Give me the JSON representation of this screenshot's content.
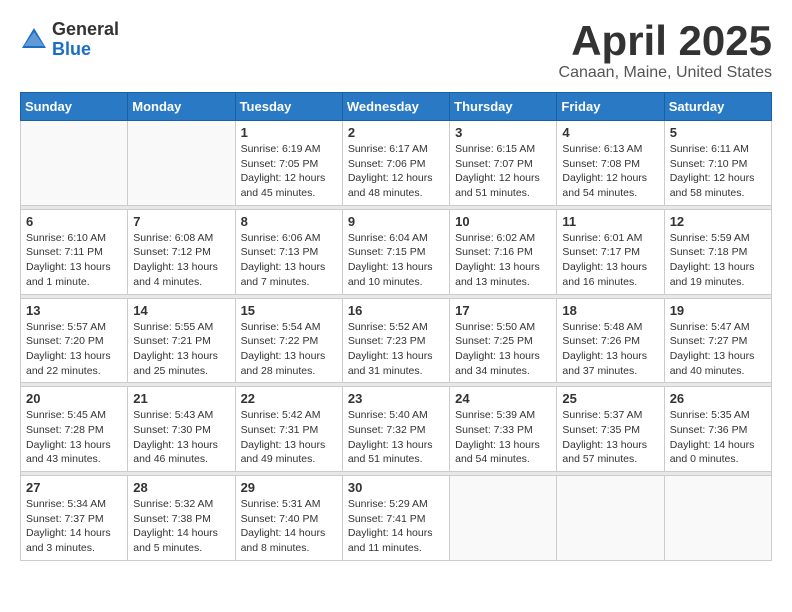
{
  "logo": {
    "general": "General",
    "blue": "Blue"
  },
  "title": "April 2025",
  "location": "Canaan, Maine, United States",
  "days_of_week": [
    "Sunday",
    "Monday",
    "Tuesday",
    "Wednesday",
    "Thursday",
    "Friday",
    "Saturday"
  ],
  "weeks": [
    [
      {
        "day": "",
        "info": ""
      },
      {
        "day": "",
        "info": ""
      },
      {
        "day": "1",
        "info": "Sunrise: 6:19 AM\nSunset: 7:05 PM\nDaylight: 12 hours\nand 45 minutes."
      },
      {
        "day": "2",
        "info": "Sunrise: 6:17 AM\nSunset: 7:06 PM\nDaylight: 12 hours\nand 48 minutes."
      },
      {
        "day": "3",
        "info": "Sunrise: 6:15 AM\nSunset: 7:07 PM\nDaylight: 12 hours\nand 51 minutes."
      },
      {
        "day": "4",
        "info": "Sunrise: 6:13 AM\nSunset: 7:08 PM\nDaylight: 12 hours\nand 54 minutes."
      },
      {
        "day": "5",
        "info": "Sunrise: 6:11 AM\nSunset: 7:10 PM\nDaylight: 12 hours\nand 58 minutes."
      }
    ],
    [
      {
        "day": "6",
        "info": "Sunrise: 6:10 AM\nSunset: 7:11 PM\nDaylight: 13 hours\nand 1 minute."
      },
      {
        "day": "7",
        "info": "Sunrise: 6:08 AM\nSunset: 7:12 PM\nDaylight: 13 hours\nand 4 minutes."
      },
      {
        "day": "8",
        "info": "Sunrise: 6:06 AM\nSunset: 7:13 PM\nDaylight: 13 hours\nand 7 minutes."
      },
      {
        "day": "9",
        "info": "Sunrise: 6:04 AM\nSunset: 7:15 PM\nDaylight: 13 hours\nand 10 minutes."
      },
      {
        "day": "10",
        "info": "Sunrise: 6:02 AM\nSunset: 7:16 PM\nDaylight: 13 hours\nand 13 minutes."
      },
      {
        "day": "11",
        "info": "Sunrise: 6:01 AM\nSunset: 7:17 PM\nDaylight: 13 hours\nand 16 minutes."
      },
      {
        "day": "12",
        "info": "Sunrise: 5:59 AM\nSunset: 7:18 PM\nDaylight: 13 hours\nand 19 minutes."
      }
    ],
    [
      {
        "day": "13",
        "info": "Sunrise: 5:57 AM\nSunset: 7:20 PM\nDaylight: 13 hours\nand 22 minutes."
      },
      {
        "day": "14",
        "info": "Sunrise: 5:55 AM\nSunset: 7:21 PM\nDaylight: 13 hours\nand 25 minutes."
      },
      {
        "day": "15",
        "info": "Sunrise: 5:54 AM\nSunset: 7:22 PM\nDaylight: 13 hours\nand 28 minutes."
      },
      {
        "day": "16",
        "info": "Sunrise: 5:52 AM\nSunset: 7:23 PM\nDaylight: 13 hours\nand 31 minutes."
      },
      {
        "day": "17",
        "info": "Sunrise: 5:50 AM\nSunset: 7:25 PM\nDaylight: 13 hours\nand 34 minutes."
      },
      {
        "day": "18",
        "info": "Sunrise: 5:48 AM\nSunset: 7:26 PM\nDaylight: 13 hours\nand 37 minutes."
      },
      {
        "day": "19",
        "info": "Sunrise: 5:47 AM\nSunset: 7:27 PM\nDaylight: 13 hours\nand 40 minutes."
      }
    ],
    [
      {
        "day": "20",
        "info": "Sunrise: 5:45 AM\nSunset: 7:28 PM\nDaylight: 13 hours\nand 43 minutes."
      },
      {
        "day": "21",
        "info": "Sunrise: 5:43 AM\nSunset: 7:30 PM\nDaylight: 13 hours\nand 46 minutes."
      },
      {
        "day": "22",
        "info": "Sunrise: 5:42 AM\nSunset: 7:31 PM\nDaylight: 13 hours\nand 49 minutes."
      },
      {
        "day": "23",
        "info": "Sunrise: 5:40 AM\nSunset: 7:32 PM\nDaylight: 13 hours\nand 51 minutes."
      },
      {
        "day": "24",
        "info": "Sunrise: 5:39 AM\nSunset: 7:33 PM\nDaylight: 13 hours\nand 54 minutes."
      },
      {
        "day": "25",
        "info": "Sunrise: 5:37 AM\nSunset: 7:35 PM\nDaylight: 13 hours\nand 57 minutes."
      },
      {
        "day": "26",
        "info": "Sunrise: 5:35 AM\nSunset: 7:36 PM\nDaylight: 14 hours\nand 0 minutes."
      }
    ],
    [
      {
        "day": "27",
        "info": "Sunrise: 5:34 AM\nSunset: 7:37 PM\nDaylight: 14 hours\nand 3 minutes."
      },
      {
        "day": "28",
        "info": "Sunrise: 5:32 AM\nSunset: 7:38 PM\nDaylight: 14 hours\nand 5 minutes."
      },
      {
        "day": "29",
        "info": "Sunrise: 5:31 AM\nSunset: 7:40 PM\nDaylight: 14 hours\nand 8 minutes."
      },
      {
        "day": "30",
        "info": "Sunrise: 5:29 AM\nSunset: 7:41 PM\nDaylight: 14 hours\nand 11 minutes."
      },
      {
        "day": "",
        "info": ""
      },
      {
        "day": "",
        "info": ""
      },
      {
        "day": "",
        "info": ""
      }
    ]
  ]
}
